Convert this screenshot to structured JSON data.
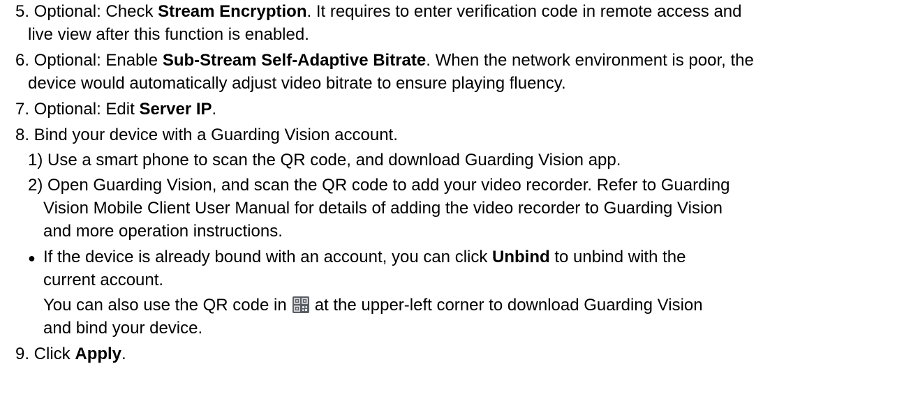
{
  "steps": {
    "s5": {
      "prefix": "5. Optional: Check ",
      "bold": "Stream Encryption",
      "rest": ". It requires to enter verification code in remote access and",
      "cont": "live view after this function is enabled."
    },
    "s6": {
      "prefix": "6. Optional: Enable ",
      "bold": "Sub-Stream Self-Adaptive Bitrate",
      "rest": ". When the network environment is poor, the",
      "cont": "device would automatically adjust video bitrate to ensure playing fluency."
    },
    "s7": {
      "prefix": "7. Optional: Edit ",
      "bold": "Server IP",
      "rest": "."
    },
    "s8": {
      "text": "8. Bind your device with a Guarding Vision account.",
      "sub1": "1) Use a smart phone to scan the QR code, and download Guarding Vision app.",
      "sub2_l1": "2) Open Guarding Vision, and scan the QR code to add your video recorder. Refer to Guarding",
      "sub2_l2": "Vision Mobile Client User Manual for details of adding the video recorder to Guarding Vision",
      "sub2_l3": "and more operation instructions.",
      "bullet_mark": "●",
      "bullet_prefix": "If the device is already bound with an account, you can click ",
      "bullet_bold": "Unbind",
      "bullet_rest": " to unbind with the",
      "bullet_cont": "current account.",
      "note_prefix": "You can also use the QR code in",
      "note_rest": "at the upper-left corner to download Guarding Vision",
      "note_cont": "and bind your device."
    },
    "s9": {
      "prefix": "9. Click ",
      "bold": "Apply",
      "rest": "."
    }
  },
  "icons": {
    "qr": "qr-code-icon"
  }
}
